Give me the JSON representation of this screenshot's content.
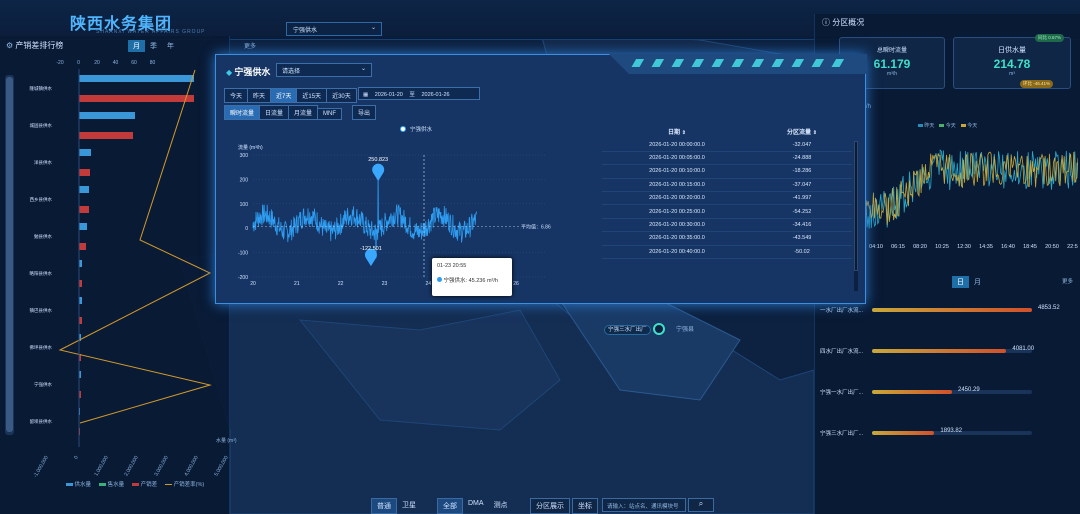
{
  "header": {
    "logo_text": "陕西水务集团",
    "logo_sub": "SHAANXI WATER AFFAIRS GROUP",
    "top_select": "宁强供水"
  },
  "left_panel": {
    "title": "产销差排行榜",
    "tabs": [
      "月",
      "季",
      "年"
    ],
    "more": "更多",
    "x_ticks_top": [
      "-20",
      "0",
      "20",
      "40",
      "60",
      "80"
    ],
    "x_ticks_bottom": [
      "-1,000,000",
      "0",
      "1,000,000",
      "2,000,000",
      "3,000,000",
      "4,000,000",
      "5,000,000"
    ],
    "x_unit": "水量 (m³)",
    "rows": [
      "隆城镇供水",
      "城固县供水",
      "洋县供水",
      "西乡县供水",
      "勉县供水",
      "略阳县供水",
      "镇巴县供水",
      "佛坪县供水",
      "宁强供水",
      "留坝县供水"
    ],
    "legend": [
      "供水量",
      "售水量",
      "产销差",
      "产销差率(%)"
    ]
  },
  "modal": {
    "title": "宁强供水",
    "select_placeholder": "请选择",
    "range_buttons": [
      "今天",
      "昨天",
      "近7天",
      "近15天",
      "近30天"
    ],
    "date_start": "2026-01-20",
    "date_sep": "至",
    "date_end": "2026-01-26",
    "mode_buttons": [
      "瞬时流量",
      "日流量",
      "月流量",
      "MNF"
    ],
    "export_label": "导出",
    "legend_label": "宁强供水",
    "y_axis_title": "流量 (m³/h)",
    "y_ticks": [
      "300",
      "200",
      "100",
      "0",
      "-100",
      "-200"
    ],
    "x_ticks": [
      "20",
      "21",
      "22",
      "23",
      "24",
      "25",
      "26"
    ],
    "max_label": "250.823",
    "min_label": "-122.501",
    "avg_label": "平均值：6.86",
    "tooltip_title": "01-23 20:55",
    "tooltip_value": "宁强供水: 45.236 m³/h",
    "table_headers": [
      "日期",
      "分区流量"
    ],
    "table_rows": [
      [
        "2026-01-20 00:00:00.0",
        "-32.047"
      ],
      [
        "2026-01-20 00:05:00.0",
        "-24.888"
      ],
      [
        "2026-01-20 00:10:00.0",
        "-18.286"
      ],
      [
        "2026-01-20 00:15:00.0",
        "-37.047"
      ],
      [
        "2026-01-20 00:20:00.0",
        "-41.997"
      ],
      [
        "2026-01-20 00:25:00.0",
        "-54.252"
      ],
      [
        "2026-01-20 00:30:00.0",
        "-34.416"
      ],
      [
        "2026-01-20 00:35:00.0",
        "-43.549"
      ],
      [
        "2026-01-20 00:40:00.0",
        "-50.02"
      ]
    ]
  },
  "chart_data": {
    "type": "line",
    "series": [
      {
        "name": "宁强供水"
      }
    ],
    "ylim": [
      -200,
      300
    ],
    "xlim": [
      20,
      26
    ],
    "max": 250.823,
    "min": -122.501,
    "average": 6.86,
    "tooltip": {
      "time": "01-23 20:55",
      "value": 45.236
    }
  },
  "right_panel": {
    "title": "分区概况",
    "card1_label": "总瞬时流量",
    "card1_value": "61.179",
    "card1_unit": "m³/h",
    "card2_label": "日供水量",
    "card2_value": "214.78",
    "card2_unit": "m³",
    "badge1": "同比 0.67%",
    "badge2": "环比 -46.41%",
    "unit_frag": "/h",
    "legend": [
      "昨天",
      "今天",
      "今天"
    ],
    "x_ticks": [
      "04:10",
      "06:15",
      "08:20",
      "10:25",
      "12:30",
      "14:35",
      "16:40",
      "18:45",
      "20:50",
      "22:55"
    ],
    "tabs": [
      "日",
      "月"
    ],
    "more": "更多",
    "bars": [
      {
        "label": "一水厂出厂水流...",
        "value": "4853.52",
        "pct": 1.0
      },
      {
        "label": "四水厂出厂水流...",
        "value": "4081.00",
        "pct": 0.84
      },
      {
        "label": "宁强一水厂出厂...",
        "value": "2450.29",
        "pct": 0.5
      },
      {
        "label": "宁强三水厂出厂...",
        "value": "1893.82",
        "pct": 0.39
      }
    ]
  },
  "map": {
    "station_label": "宁强三水厂出厂",
    "town_label": "宁强县"
  },
  "bottom_bar": {
    "buttons1": [
      "普通",
      "卫星"
    ],
    "buttons2": [
      "全部",
      "DMA",
      "测点"
    ],
    "buttons3": [
      "分区展示",
      "坐标"
    ],
    "search_placeholder": "请输入：站点名、通讯模块号"
  }
}
